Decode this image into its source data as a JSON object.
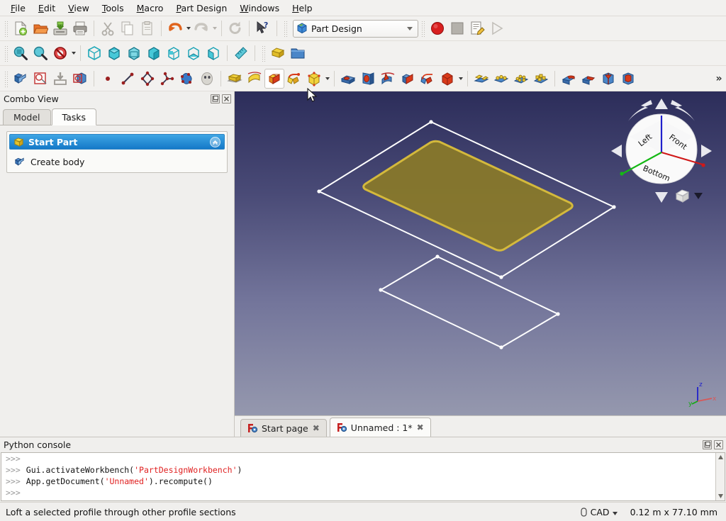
{
  "menubar": {
    "items": [
      {
        "label": "File",
        "accel": "F"
      },
      {
        "label": "Edit",
        "accel": "E"
      },
      {
        "label": "View",
        "accel": "V"
      },
      {
        "label": "Tools",
        "accel": "T"
      },
      {
        "label": "Macro",
        "accel": "M"
      },
      {
        "label": "Part Design",
        "accel": "P"
      },
      {
        "label": "Windows",
        "accel": "W"
      },
      {
        "label": "Help",
        "accel": "H"
      }
    ]
  },
  "toolbar_file": {
    "buttons": [
      {
        "name": "new-document-icon",
        "tip": "New"
      },
      {
        "name": "open-document-icon",
        "tip": "Open"
      },
      {
        "name": "save-document-icon",
        "tip": "Save"
      },
      {
        "name": "print-icon",
        "tip": "Print"
      },
      {
        "name": "cut-icon",
        "tip": "Cut"
      },
      {
        "name": "copy-icon",
        "tip": "Copy"
      },
      {
        "name": "paste-icon",
        "tip": "Paste"
      },
      {
        "name": "undo-icon",
        "tip": "Undo"
      },
      {
        "name": "redo-icon",
        "tip": "Redo"
      },
      {
        "name": "refresh-icon",
        "tip": "Refresh"
      },
      {
        "name": "whats-this-icon",
        "tip": "What's This"
      }
    ],
    "workbench": {
      "label": "Part Design",
      "icon": "workbench-icon"
    },
    "macro": [
      {
        "name": "macro-record-icon",
        "tip": "Record macro"
      },
      {
        "name": "macro-stop-icon",
        "tip": "Stop macro"
      },
      {
        "name": "macro-edit-icon",
        "tip": "Macros"
      },
      {
        "name": "macro-execute-icon",
        "tip": "Execute macro"
      }
    ]
  },
  "toolbar_view": {
    "buttons": [
      {
        "name": "fit-all-icon"
      },
      {
        "name": "fit-selection-icon"
      },
      {
        "name": "draw-style-icon"
      },
      {
        "name": "axonometric-view-icon"
      },
      {
        "name": "front-view-icon"
      },
      {
        "name": "top-view-icon"
      },
      {
        "name": "right-view-icon"
      },
      {
        "name": "rear-view-icon"
      },
      {
        "name": "bottom-view-icon"
      },
      {
        "name": "left-view-icon"
      },
      {
        "name": "measure-icon"
      },
      {
        "name": "part-box-icon"
      },
      {
        "name": "create-group-icon"
      }
    ]
  },
  "toolbar_partdesign": {
    "buttons": [
      {
        "name": "create-body-icon"
      },
      {
        "name": "create-sketch-icon"
      },
      {
        "name": "attach-sketch-icon"
      },
      {
        "name": "shape-binder-icon"
      },
      {
        "name": "create-point-icon"
      },
      {
        "name": "create-line-icon"
      },
      {
        "name": "create-polyline-icon"
      },
      {
        "name": "create-arc-icon"
      },
      {
        "name": "create-bspline-icon"
      },
      {
        "name": "create-shape-icon"
      },
      {
        "name": "pad-icon"
      },
      {
        "name": "revolution-icon"
      },
      {
        "name": "loft-icon"
      },
      {
        "name": "additive-pipe-icon"
      },
      {
        "name": "additive-primitive-icon"
      },
      {
        "name": "pocket-icon"
      },
      {
        "name": "hole-icon"
      },
      {
        "name": "groove-icon"
      },
      {
        "name": "subtractive-loft-icon"
      },
      {
        "name": "subtractive-pipe-icon"
      },
      {
        "name": "subtractive-primitive-icon"
      },
      {
        "name": "mirrored-icon"
      },
      {
        "name": "linear-pattern-icon"
      },
      {
        "name": "polar-pattern-icon"
      },
      {
        "name": "multi-transform-icon"
      },
      {
        "name": "fillet-icon"
      },
      {
        "name": "chamfer-icon"
      },
      {
        "name": "draft-icon"
      },
      {
        "name": "thickness-icon"
      }
    ],
    "hovered": "loft-icon",
    "overflow_label": "»"
  },
  "combo_view": {
    "title": "Combo View",
    "tabs": [
      {
        "label": "Model",
        "active": false
      },
      {
        "label": "Tasks",
        "active": true
      }
    ],
    "task_panel": {
      "header": "Start Part",
      "header_icon": "part-box-icon",
      "collapse_icon": "chevron-up-icon",
      "items": [
        {
          "label": "Create body",
          "icon": "create-body-icon"
        }
      ]
    },
    "float_icon": "float-panel-icon",
    "close_icon": "close-panel-icon"
  },
  "viewport": {
    "background_top": "#2c2d5a",
    "background_bottom": "#9598ae",
    "profile_fill": "#8a7a28",
    "profile_edge": "#d4b93c",
    "wire_color": "#ffffff",
    "navcube": {
      "faces": [
        "Left",
        "Front",
        "Bottom"
      ],
      "axis_colors": {
        "x": "#d01818",
        "y": "#14b814",
        "z": "#2020cc"
      },
      "arrows": [
        "nav-arrow-up",
        "nav-arrow-down",
        "nav-arrow-left",
        "nav-arrow-right",
        "nav-rotate-left",
        "nav-rotate-right"
      ],
      "corner_cube": "nav-corner-cube",
      "corner_menu": "nav-corner-menu"
    },
    "axis_indicator": {
      "x": "x",
      "y": "y",
      "z": "z"
    }
  },
  "document_tabs": [
    {
      "label": "Start page",
      "active": false,
      "close": "✖",
      "icon": "freecad-logo-icon"
    },
    {
      "label": "Unnamed : 1*",
      "active": true,
      "close": "✖",
      "icon": "freecad-logo-icon"
    }
  ],
  "python_console": {
    "title": "Python console",
    "float_icon": "float-panel-icon",
    "close_icon": "close-panel-icon",
    "lines": [
      {
        "prompt": ">>>",
        "pre": "",
        "str": "",
        "post": ""
      },
      {
        "prompt": ">>>",
        "pre": "Gui.activateWorkbench(",
        "str": "'PartDesignWorkbench'",
        "post": ")"
      },
      {
        "prompt": ">>>",
        "pre": "App.getDocument(",
        "str": "'Unnamed'",
        "post": ").recompute()"
      },
      {
        "prompt": ">>>",
        "pre": "",
        "str": "",
        "post": ""
      }
    ]
  },
  "statusbar": {
    "message": "Loft a selected profile through other profile sections",
    "unit_label": "CAD",
    "unit_icon": "unit-icon",
    "dimensions": "0.12 m x 77.10 mm"
  }
}
